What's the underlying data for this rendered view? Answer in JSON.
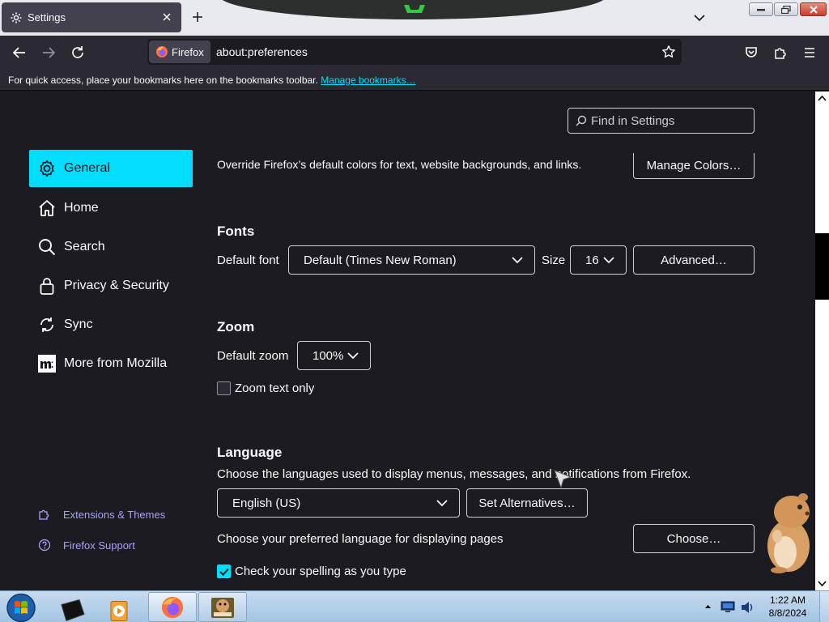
{
  "browser": {
    "tab_title": "Settings",
    "identity_label": "Firefox",
    "url": "about:preferences"
  },
  "bookmarks_bar": {
    "message": "For quick access, place your bookmarks here on the bookmarks toolbar.",
    "link": "Manage bookmarks…"
  },
  "search": {
    "placeholder": "Find in Settings"
  },
  "sidebar": {
    "categories": [
      {
        "label": "General",
        "icon": "gear-icon",
        "selected": true
      },
      {
        "label": "Home",
        "icon": "home-icon"
      },
      {
        "label": "Search",
        "icon": "search-icon"
      },
      {
        "label": "Privacy & Security",
        "icon": "lock-icon"
      },
      {
        "label": "Sync",
        "icon": "sync-icon"
      },
      {
        "label": "More from Mozilla",
        "icon": "mozilla-icon"
      }
    ],
    "footer_links": [
      {
        "label": "Extensions & Themes",
        "icon": "puzzle-icon"
      },
      {
        "label": "Firefox Support",
        "icon": "help-icon"
      }
    ]
  },
  "colors_section": {
    "description": "Override Firefox’s default colors for text, website backgrounds, and links.",
    "button": "Manage Colors…"
  },
  "fonts": {
    "heading": "Fonts",
    "default_font_label": "Default font",
    "default_font_value": "Default (Times New Roman)",
    "size_label": "Size",
    "size_value": "16",
    "advanced_button": "Advanced…"
  },
  "zoom": {
    "heading": "Zoom",
    "default_zoom_label": "Default zoom",
    "default_zoom_value": "100%",
    "text_only_label": "Zoom text only",
    "text_only_checked": false
  },
  "language": {
    "heading": "Language",
    "description": "Choose the languages used to display menus, messages, and notifications from Firefox.",
    "selected_language": "English (US)",
    "set_alternatives_button": "Set Alternatives…",
    "pages_description": "Choose your preferred language for displaying pages",
    "choose_button": "Choose…",
    "spellcheck_label": "Check your spelling as you type",
    "spellcheck_checked": true
  },
  "taskbar": {
    "time": "1:22 AM",
    "date": "8/8/2024"
  },
  "colors": {
    "accent": "#00ddff",
    "background": "#1c1b22",
    "toolbar": "#2b2a33",
    "link": "#a7a2ff"
  }
}
